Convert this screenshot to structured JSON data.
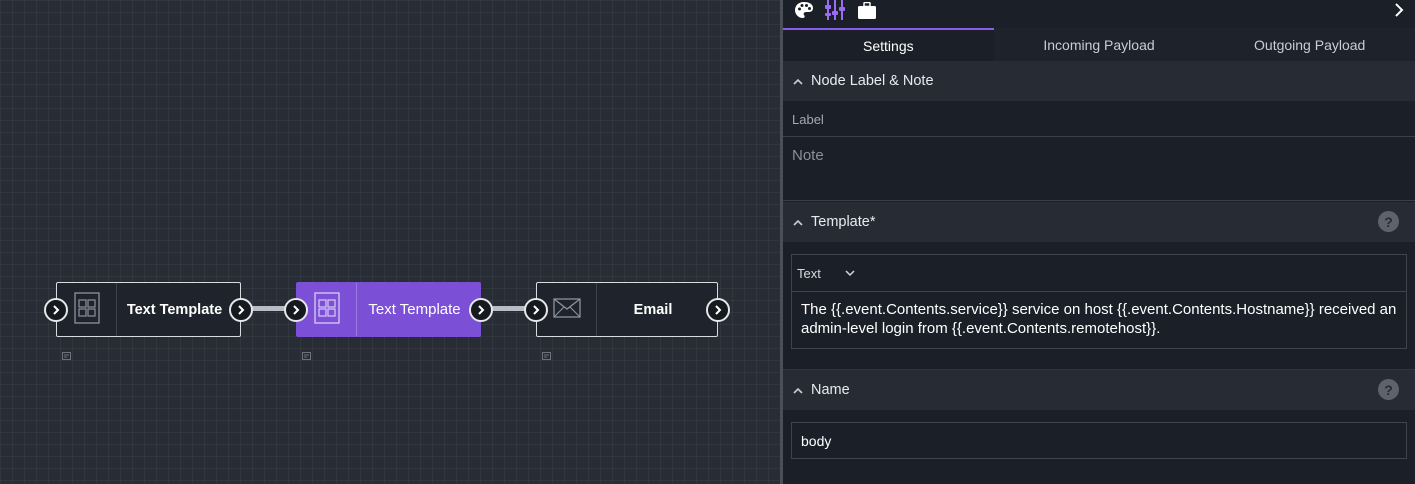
{
  "canvas": {
    "nodes": [
      {
        "label": "Text Template",
        "icon": "grid-template-icon",
        "selected": false
      },
      {
        "label": "Text Template",
        "icon": "grid-template-icon",
        "selected": true
      },
      {
        "label": "Email",
        "icon": "envelope-icon",
        "selected": false
      }
    ]
  },
  "panel": {
    "toolbar": {
      "icons": [
        "palette-icon",
        "transform-icon",
        "briefcase-icon",
        "chevron-right-icon"
      ]
    },
    "tabs": [
      {
        "label": "Settings",
        "active": true
      },
      {
        "label": "Incoming Payload",
        "active": false
      },
      {
        "label": "Outgoing Payload",
        "active": false
      }
    ],
    "node_label_section": {
      "title": "Node Label & Note",
      "label_placeholder": "Label",
      "note_placeholder": "Note"
    },
    "template_section": {
      "title": "Template*",
      "type": "Text",
      "value": "The {{.event.Contents.service}} service on host {{.event.Contents.Hostname}} received an admin-level login from {{.event.Contents.remotehost}}."
    },
    "name_section": {
      "title": "Name",
      "value": "body"
    },
    "help_glyph": "?"
  },
  "colors": {
    "accent": "#8a5cf0",
    "selected_node": "#7b4fd6",
    "canvas_bg": "#272c35",
    "panel_bg": "#1b1f27"
  }
}
